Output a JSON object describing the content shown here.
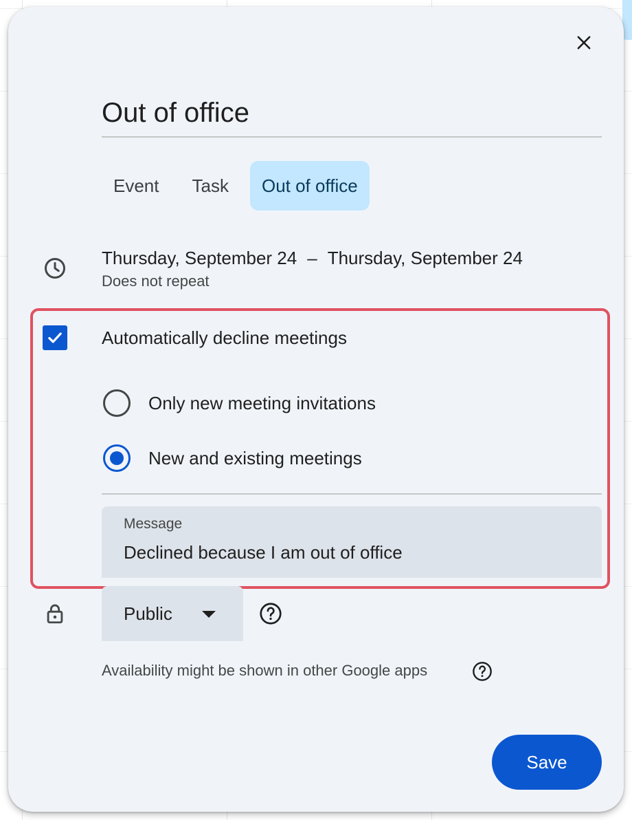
{
  "dialog": {
    "title": "Out of office",
    "close_icon": "close-icon"
  },
  "tabs": [
    {
      "label": "Event",
      "active": false
    },
    {
      "label": "Task",
      "active": false
    },
    {
      "label": "Out of office",
      "active": true
    }
  ],
  "schedule": {
    "icon": "clock-icon",
    "start": "Thursday, September 24",
    "separator": "–",
    "end": "Thursday, September 24",
    "repeat": "Does not repeat"
  },
  "auto_decline": {
    "checked": true,
    "label": "Automatically decline meetings",
    "options": [
      {
        "label": "Only new meeting invitations",
        "selected": false
      },
      {
        "label": "New and existing meetings",
        "selected": true
      }
    ],
    "message": {
      "label": "Message",
      "value": "Declined because I am out of office"
    }
  },
  "visibility": {
    "icon": "lock-icon",
    "value": "Public",
    "help_icon": "help-circle-icon"
  },
  "availability_note": "Availability might be shown in other Google apps",
  "save_label": "Save",
  "colors": {
    "primary": "#0b57d0",
    "tab_active_bg": "#c2e7ff",
    "dialog_bg": "#f0f4f9",
    "highlight": "#e05260"
  }
}
